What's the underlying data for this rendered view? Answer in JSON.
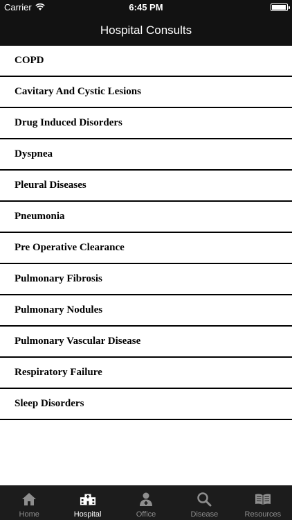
{
  "status_bar": {
    "carrier": "Carrier",
    "time": "6:45 PM"
  },
  "nav": {
    "title": "Hospital Consults"
  },
  "list": {
    "items": [
      "COPD",
      "Cavitary And Cystic Lesions",
      "Drug Induced Disorders",
      "Dyspnea",
      "Pleural Diseases",
      "Pneumonia",
      "Pre Operative Clearance",
      "Pulmonary Fibrosis",
      "Pulmonary Nodules",
      "Pulmonary Vascular Disease",
      "Respiratory Failure",
      "Sleep Disorders"
    ]
  },
  "tabs": [
    {
      "label": "Home",
      "icon": "home-icon",
      "active": false
    },
    {
      "label": "Hospital",
      "icon": "hospital-icon",
      "active": true
    },
    {
      "label": "Office",
      "icon": "doctor-icon",
      "active": false
    },
    {
      "label": "Disease",
      "icon": "search-icon",
      "active": false
    },
    {
      "label": "Resources",
      "icon": "book-icon",
      "active": false
    }
  ],
  "colors": {
    "bar_background": "#121212",
    "tab_background": "#1c1c1c",
    "tab_inactive": "#8e8e8e",
    "tab_active": "#ffffff",
    "divider": "#000000"
  }
}
